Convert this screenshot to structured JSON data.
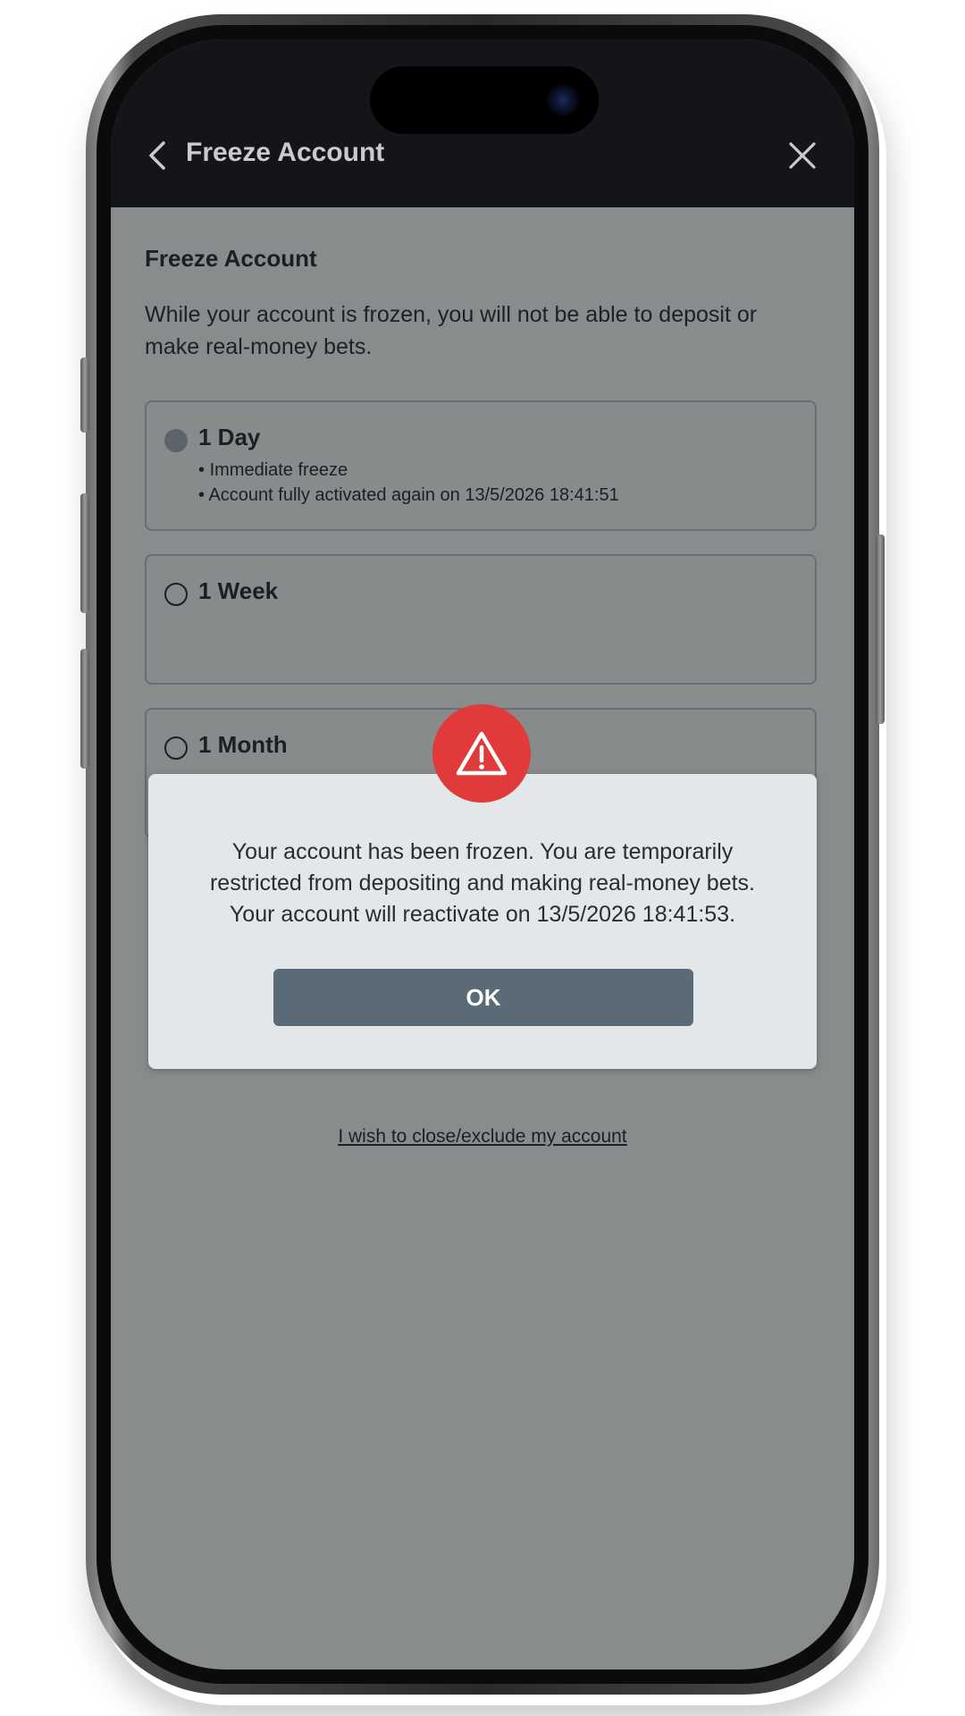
{
  "colors": {
    "header_bg": "#131518",
    "screen_overlay": "#888c8c",
    "modal_bg": "#e4e7ea",
    "ok_button": "#5a6a76",
    "warning_badge": "#e03a3a"
  },
  "header": {
    "title": "Freeze Account",
    "back_icon": "chevron-left-icon",
    "close_icon": "close-icon"
  },
  "content": {
    "section_title": "Freeze Account",
    "description": "While your account is frozen, you will not be able to deposit or make real-money bets.",
    "options": [
      {
        "label": "1 Day",
        "selected": true,
        "bullets": [
          "Immediate freeze",
          "Account fully activated again on 13/5/2026 18:41:51"
        ]
      },
      {
        "label": "1 Week",
        "selected": false,
        "bullets": []
      },
      {
        "label": "1 Month",
        "selected": false,
        "bullets": []
      }
    ],
    "close_link": "I wish to close/exclude my account"
  },
  "modal": {
    "icon": "warning-icon",
    "message_line1": "Your account has been frozen. You are temporarily",
    "message_line2": "restricted from depositing and making real-money bets.",
    "message_line3": "Your account will reactivate on 13/5/2026 18:41:53.",
    "ok_label": "OK"
  }
}
